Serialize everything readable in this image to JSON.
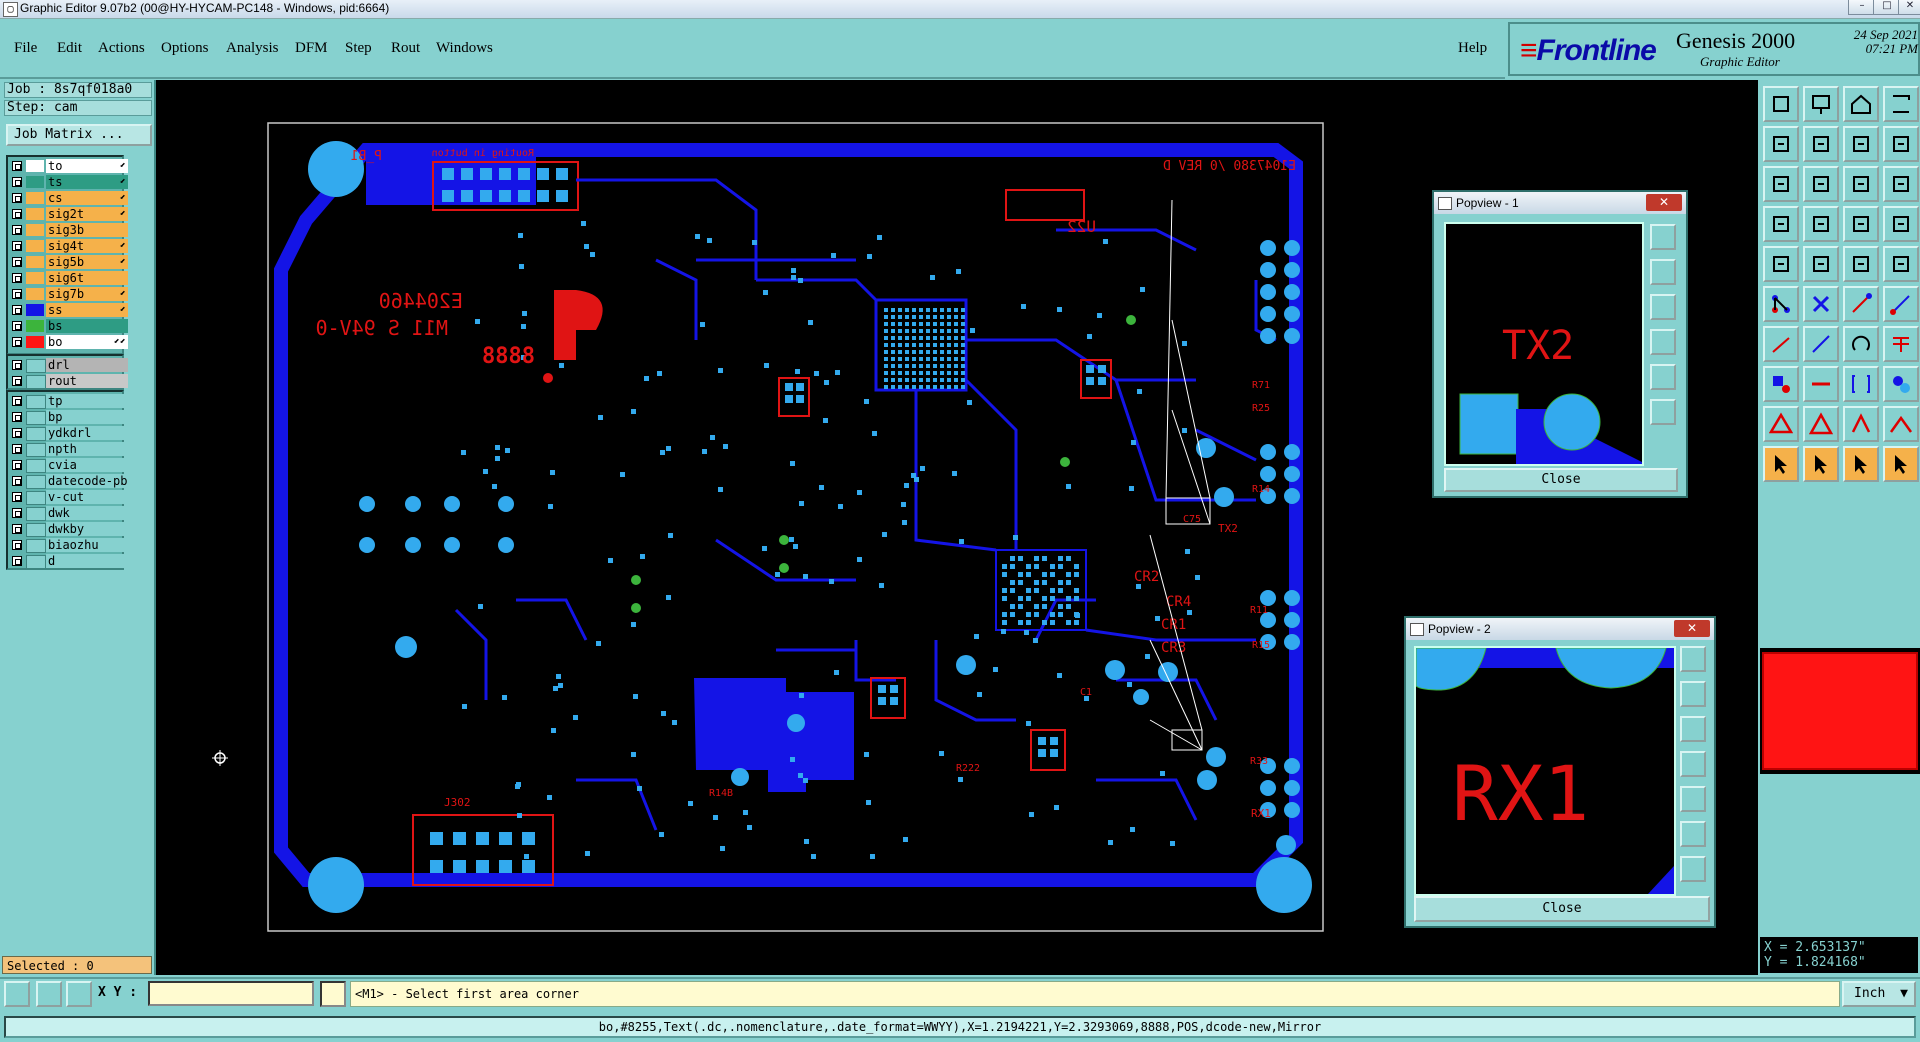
{
  "window": {
    "title": "Graphic Editor 9.07b2 (00@HY-HYCAM-PC148 - Windows, pid:6664)"
  },
  "menu": {
    "file": "File",
    "edit": "Edit",
    "actions": "Actions",
    "options": "Options",
    "analysis": "Analysis",
    "dfm": "DFM",
    "step": "Step",
    "rout": "Rout",
    "windows": "Windows",
    "help": "Help"
  },
  "brand": {
    "logo": "Frontline",
    "product": "Genesis 2000",
    "subtitle": "Graphic Editor",
    "date": "24 Sep 2021",
    "time": "07:21 PM"
  },
  "job": {
    "job_label": "Job : 8s7qf018a0",
    "step_label": "Step: cam",
    "matrix_button": "Job Matrix ..."
  },
  "colors": {
    "board_bg": "#000000",
    "copper": "#1414e6",
    "pad": "#33aaee",
    "silk": "#e01414",
    "outline": "#c8c8c8",
    "panel": "#86d1cf",
    "via_green": "#3cb43c"
  },
  "layers_signal": [
    {
      "name": "to",
      "color": "#ffffff",
      "name_bg": "#ffffff",
      "arrow": "⬋"
    },
    {
      "name": "ts",
      "color": "#2e9c84",
      "name_bg": "#2e9c84",
      "arrow": "⬋"
    },
    {
      "name": "cs",
      "color": "#f5b14a",
      "name_bg": "#f5b14a",
      "arrow": "⬋"
    },
    {
      "name": "sig2t",
      "color": "#f5b14a",
      "name_bg": "#f5b14a",
      "arrow": "⬋"
    },
    {
      "name": "sig3b",
      "color": "#f5b14a",
      "name_bg": "#f5b14a",
      "arrow": ""
    },
    {
      "name": "sig4t",
      "color": "#f5b14a",
      "name_bg": "#f5b14a",
      "arrow": "⬋"
    },
    {
      "name": "sig5b",
      "color": "#f5b14a",
      "name_bg": "#f5b14a",
      "arrow": "⬋"
    },
    {
      "name": "sig6t",
      "color": "#f5b14a",
      "name_bg": "#f5b14a",
      "arrow": ""
    },
    {
      "name": "sig7b",
      "color": "#f5b14a",
      "name_bg": "#f5b14a",
      "arrow": "⬋"
    },
    {
      "name": "ss",
      "color": "#1414e6",
      "name_bg": "#f5b14a",
      "arrow": "⬋"
    },
    {
      "name": "bs",
      "color": "#3cb43c",
      "name_bg": "#2e9c84",
      "arrow": ""
    },
    {
      "name": "bo",
      "color": "#ff1414",
      "name_bg": "#ffffff",
      "arrow": "⬋⬋"
    }
  ],
  "layers_drill": [
    {
      "name": "drl",
      "color": "#86d1cf",
      "name_bg": "#b4b4b4",
      "arrow": ""
    },
    {
      "name": "rout",
      "color": "#86d1cf",
      "name_bg": "#c8c8c8",
      "arrow": ""
    }
  ],
  "layers_misc": [
    {
      "name": "tp",
      "color": "#86d1cf",
      "name_bg": "#86d1cf",
      "arrow": ""
    },
    {
      "name": "bp",
      "color": "#86d1cf",
      "name_bg": "#86d1cf",
      "arrow": ""
    },
    {
      "name": "ydkdrl",
      "color": "#86d1cf",
      "name_bg": "#86d1cf",
      "arrow": ""
    },
    {
      "name": "npth",
      "color": "#86d1cf",
      "name_bg": "#86d1cf",
      "arrow": ""
    },
    {
      "name": "cvia",
      "color": "#86d1cf",
      "name_bg": "#86d1cf",
      "arrow": ""
    },
    {
      "name": "datecode-pb",
      "color": "#86d1cf",
      "name_bg": "#86d1cf",
      "arrow": ""
    },
    {
      "name": "v-cut",
      "color": "#86d1cf",
      "name_bg": "#86d1cf",
      "arrow": ""
    },
    {
      "name": "dwk",
      "color": "#86d1cf",
      "name_bg": "#86d1cf",
      "arrow": ""
    },
    {
      "name": "dwkby",
      "color": "#86d1cf",
      "name_bg": "#86d1cf",
      "arrow": ""
    },
    {
      "name": "biaozhu",
      "color": "#86d1cf",
      "name_bg": "#86d1cf",
      "arrow": ""
    },
    {
      "name": "d",
      "color": "#86d1cf",
      "name_bg": "#86d1cf",
      "arrow": ""
    }
  ],
  "selected": "Selected : 0",
  "coords": {
    "x": "X = 2.653137\"",
    "y": "Y = 1.824168\""
  },
  "bottom": {
    "xy_label": "X Y :",
    "xy_value": "",
    "message": "<M1> - Select first area corner",
    "unit": "Inch",
    "status": "bo,#8255,Text(.dc,.nomenclature,.date_format=WWYY),X=1.2194221,Y=2.3293069,8888,POS,dcode-new,Mirror"
  },
  "board": {
    "silk_labels": [
      "E204460",
      "M11 S 94V-0",
      "8888",
      "U22",
      "CR2",
      "CR4",
      "CR3",
      "CR1",
      "TX2",
      "RX1",
      "J302",
      "P_B1",
      "C75",
      "C1",
      "R15",
      "R11",
      "R14",
      "R33",
      "R222",
      "R14B",
      "R25",
      "R71"
    ],
    "mirror_header": "E1047380 /0 REV D",
    "mirror_top": "Routing in button"
  },
  "popview1": {
    "title": "Popview - 1",
    "close_x": "✕",
    "label": "TX2",
    "close": "Close"
  },
  "popview2": {
    "title": "Popview - 2",
    "close_x": "✕",
    "label": "RX1",
    "close": "Close"
  },
  "toolbar": {
    "icons": [
      "zoom-home",
      "zoom-in",
      "home",
      "measure",
      "pan-left",
      "pan-right",
      "fit",
      "resize",
      "zoom-fit",
      "zoom-area",
      "one-to-one",
      "help",
      "snap",
      "grid",
      "layer-colors",
      "layer-settings",
      "pad-select",
      "draw",
      "ruler",
      "target",
      "net",
      "x",
      "line-dot",
      "join",
      "line-edit",
      "pen",
      "arc",
      "align",
      "point-edit",
      "minus",
      "bracket",
      "rotate",
      "triangle-warn",
      "text-a",
      "text-b",
      "text-c",
      "cursor-a",
      "cursor-b",
      "cursor-c",
      "cursor-d"
    ]
  }
}
